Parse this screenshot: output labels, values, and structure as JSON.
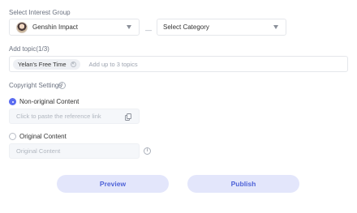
{
  "interest_group": {
    "label": "Select Interest Group",
    "game_select": {
      "value": "Genshin Impact"
    },
    "separator": "—",
    "category_select": {
      "value": "Select Category"
    }
  },
  "topics": {
    "label": "Add topic(1/3)",
    "chips": [
      {
        "label": "Yelan's Free Time"
      }
    ],
    "placeholder": "Add up to 3 topics"
  },
  "copyright": {
    "label": "Copyright Settings",
    "options": [
      {
        "label": "Non-original Content",
        "checked": true
      },
      {
        "label": "Original Content",
        "checked": false
      }
    ],
    "reference_placeholder": "Click to paste the reference link",
    "original_placeholder": "Original Content"
  },
  "actions": {
    "preview_label": "Preview",
    "publish_label": "Publish"
  },
  "colors": {
    "accent": "#5b6cf0",
    "button_bg": "#e3e6fb",
    "button_text": "#4f63d8"
  }
}
